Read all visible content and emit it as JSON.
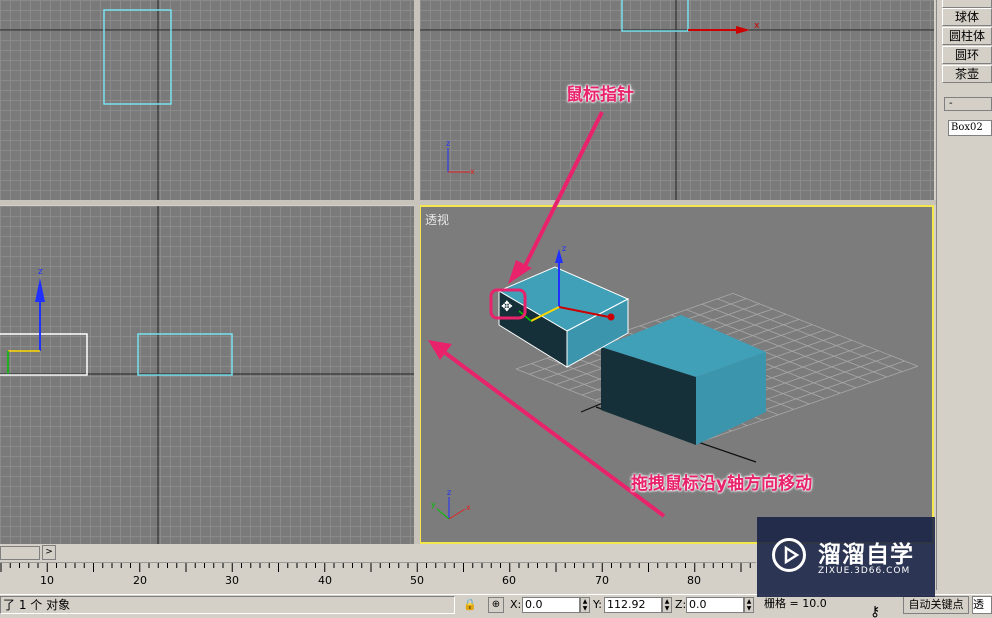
{
  "viewports": {
    "perspective_label": "透视"
  },
  "command_panel": {
    "buttons": [
      "球体",
      "圆柱体",
      "圆环",
      "茶壶"
    ],
    "rollout_minus": "-",
    "object_name": "Box02"
  },
  "timeline": {
    "scroll_arrow": ">",
    "ruler_labels": [
      "10",
      "20",
      "30",
      "40",
      "50",
      "60",
      "70",
      "80"
    ]
  },
  "status": {
    "selection_text": "了 1 个 对象",
    "x_label": "X:",
    "x_value": "0.0",
    "y_label": "Y:",
    "y_value": "112.92",
    "z_label": "Z:",
    "z_value": "0.0",
    "grid_label": "栅格 = 10.0",
    "autokey_label": "自动关键点",
    "persp_tab": "透视"
  },
  "annotations": {
    "pointer_label": "鼠标指针",
    "drag_label": "拖拽鼠标沿y轴方向移动"
  },
  "watermark": {
    "title": "溜溜自学",
    "subtitle": "ZIXUE.3D66.COM"
  },
  "colors": {
    "annotation": "#e8236b",
    "active_viewport_border": "#f3e74b",
    "box_top": "#3fa0b8",
    "box_side": "#163039"
  }
}
